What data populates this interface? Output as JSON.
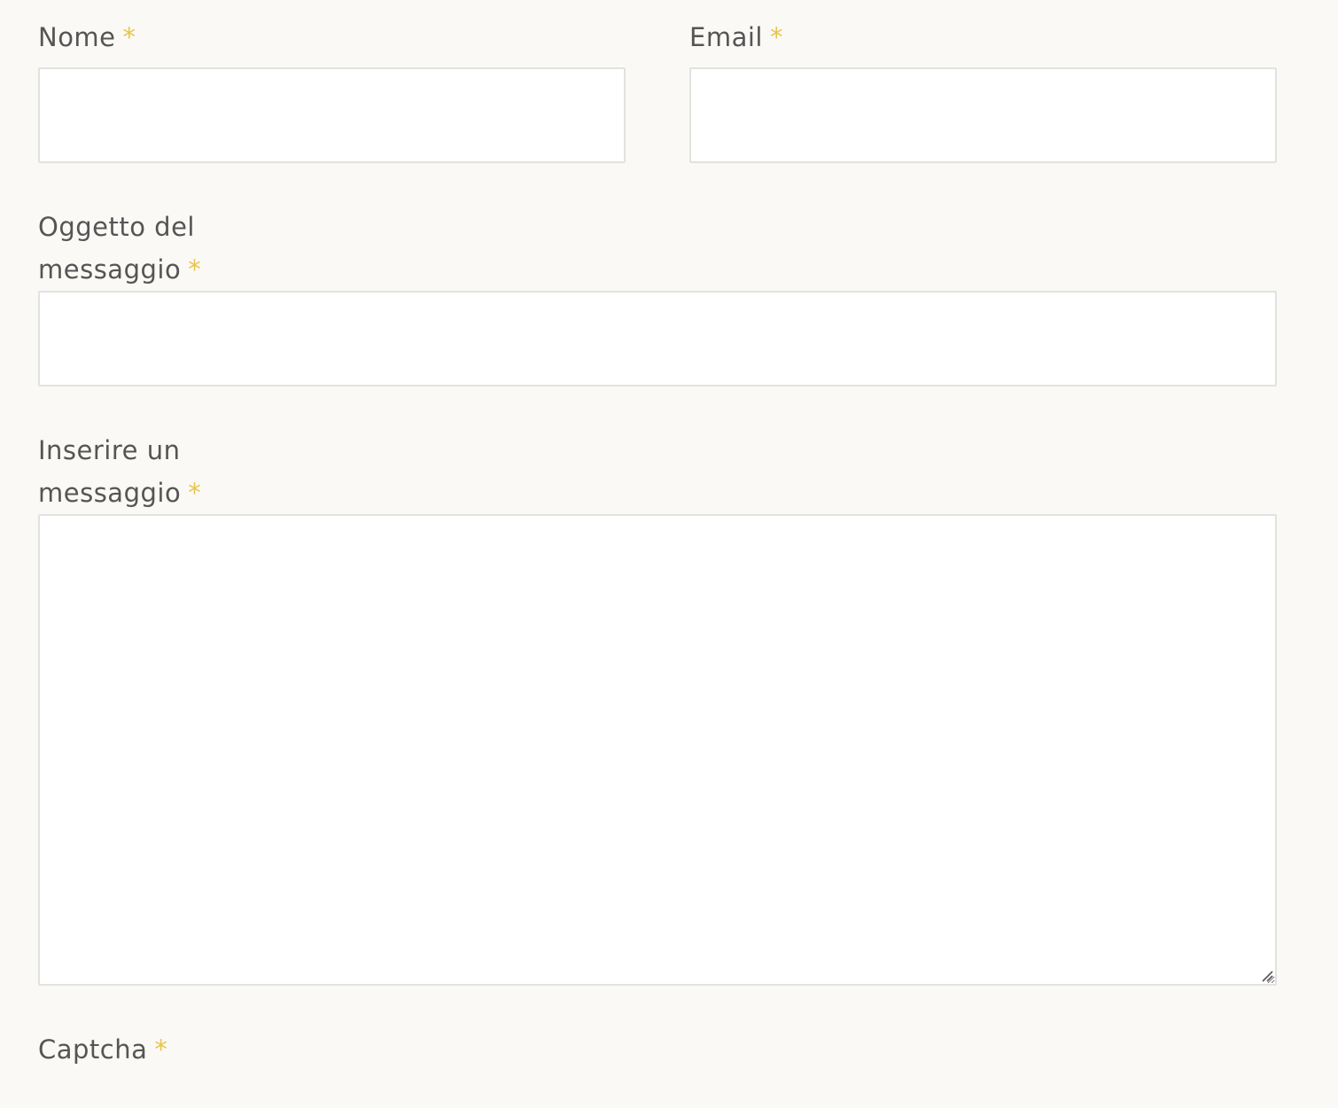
{
  "form": {
    "required_marker": "*",
    "nome": {
      "label": "Nome",
      "value": ""
    },
    "email": {
      "label": "Email",
      "value": ""
    },
    "oggetto": {
      "label_line1": "Oggetto del",
      "label_line2": "messaggio",
      "value": ""
    },
    "messaggio": {
      "label_line1": "Inserire un",
      "label_line2": "messaggio",
      "value": ""
    },
    "captcha": {
      "label": "Captcha"
    }
  },
  "colors": {
    "background": "#faf9f6",
    "label_text": "#555555",
    "required_marker": "#e8c54a",
    "field_border": "#e2e2df",
    "field_background": "#ffffff"
  }
}
